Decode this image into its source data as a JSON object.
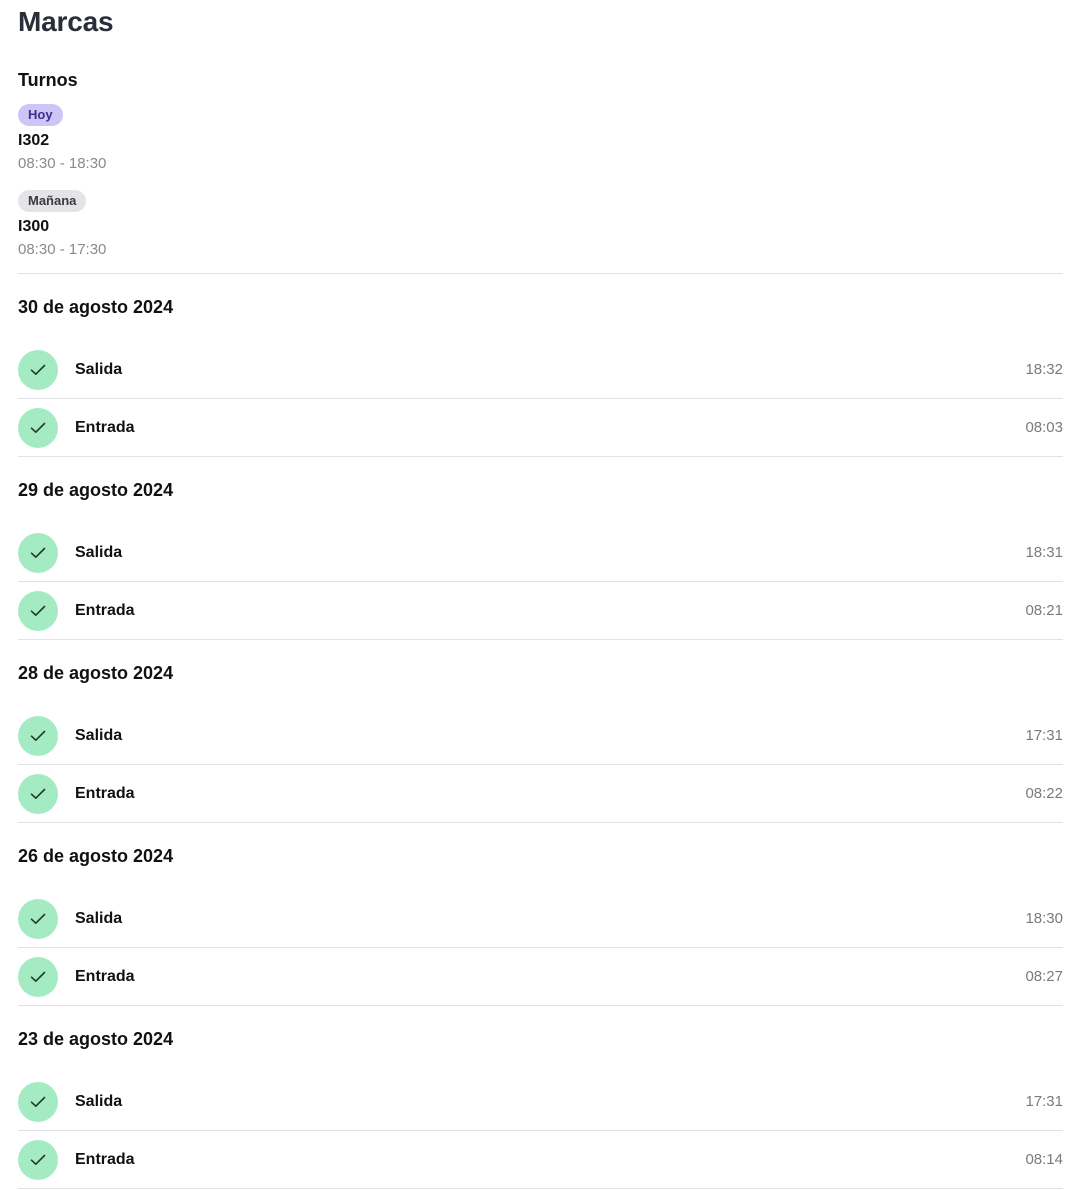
{
  "page": {
    "title": "Marcas"
  },
  "shifts": {
    "title": "Turnos",
    "items": [
      {
        "badge": "Hoy",
        "code": "I302",
        "hours": "08:30 - 18:30"
      },
      {
        "badge": "Mañana",
        "code": "I300",
        "hours": "08:30 - 17:30"
      }
    ]
  },
  "days": [
    {
      "date": "30 de agosto 2024",
      "punches": [
        {
          "label": "Salida",
          "time": "18:32"
        },
        {
          "label": "Entrada",
          "time": "08:03"
        }
      ]
    },
    {
      "date": "29 de agosto 2024",
      "punches": [
        {
          "label": "Salida",
          "time": "18:31"
        },
        {
          "label": "Entrada",
          "time": "08:21"
        }
      ]
    },
    {
      "date": "28 de agosto 2024",
      "punches": [
        {
          "label": "Salida",
          "time": "17:31"
        },
        {
          "label": "Entrada",
          "time": "08:22"
        }
      ]
    },
    {
      "date": "26 de agosto 2024",
      "punches": [
        {
          "label": "Salida",
          "time": "18:30"
        },
        {
          "label": "Entrada",
          "time": "08:27"
        }
      ]
    },
    {
      "date": "23 de agosto 2024",
      "punches": [
        {
          "label": "Salida",
          "time": "17:31"
        },
        {
          "label": "Entrada",
          "time": "08:14"
        }
      ]
    }
  ],
  "icons": {
    "punch_status": "check-icon"
  },
  "colors": {
    "check_bg": "#a4ebc4",
    "badge_today_bg": "#cfc4f8",
    "badge_tomorrow_bg": "#e4e4e7",
    "title": "#2a2d3a",
    "muted_text": "#7a7a80"
  }
}
